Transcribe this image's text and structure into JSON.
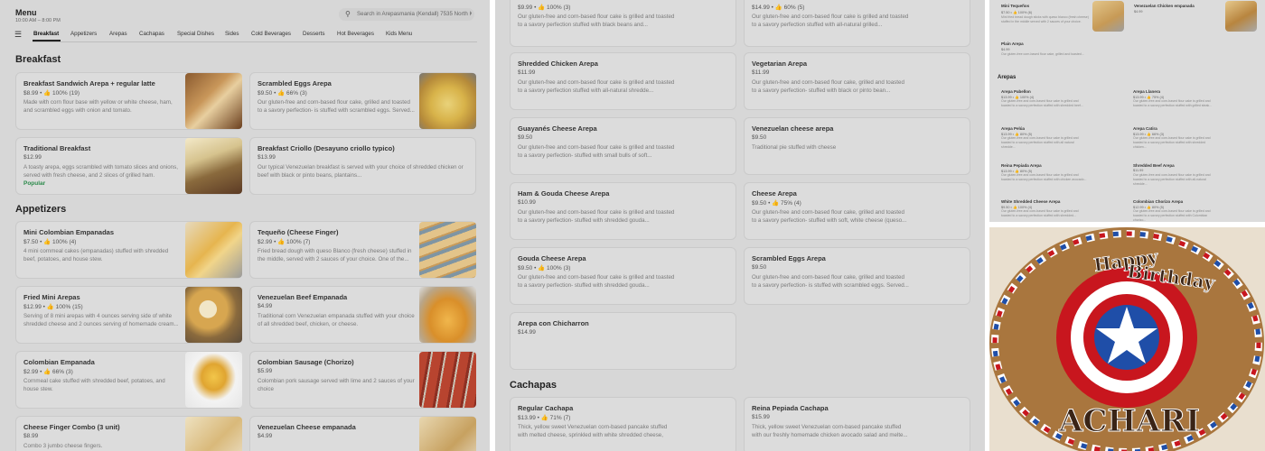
{
  "menu": {
    "title": "Menu",
    "hours": "10:00 AM – 8:00 PM",
    "search_placeholder": "Search in Arepasmania (Kendall) 7535 North K...",
    "tabs": [
      "Breakfast",
      "Appetizers",
      "Arepas",
      "Cachapas",
      "Special Dishes",
      "Sides",
      "Cold Beverages",
      "Desserts",
      "Hot Beverages",
      "Kids Menu"
    ],
    "active_tab": "Breakfast"
  },
  "breakfast": {
    "title": "Breakfast",
    "items": [
      {
        "name": "Breakfast Sandwich Arepa + regular latte",
        "price": "$8.99 • 👍 100% (19)",
        "desc": "Made with corn flour base with yellow or white cheese, ham, and scrambled eggs with onion and tomato."
      },
      {
        "name": "Scrambled Eggs Arepa",
        "price": "$9.50 • 👍 66% (3)",
        "desc": "Our gluten-free and corn-based flour cake, grilled and toasted to a savory perfection- is stuffed with scrambled eggs. Served..."
      },
      {
        "name": "Traditional Breakfast",
        "price": "$12.99",
        "desc": "A toasty arepa, eggs scrambled with tomato slices and onions, served with fresh cheese, and 2 slices of grilled ham.",
        "badge": "Popular"
      },
      {
        "name": "Breakfast Criollo (Desayuno criollo typico)",
        "price": "$13.99",
        "desc": "Our typical Venezuelan breakfast is served with your choice of shredded chicken or beef with black or pinto beans, plantains..."
      }
    ]
  },
  "appetizers": {
    "title": "Appetizers",
    "items": [
      {
        "name": "Mini Colombian Empanadas",
        "price": "$7.50 • 👍 100% (4)",
        "desc": "4 mini cornmeal cakes (empanadas) stuffed with shredded beef, potatoes, and house stew."
      },
      {
        "name": "Tequeño (Cheese Finger)",
        "price": "$2.99 • 👍 100% (7)",
        "desc": "Fried bread dough with queso Blanco (fresh cheese) stuffed in the middle, served with 2 sauces of your choice. One of the..."
      },
      {
        "name": "Fried Mini Arepas",
        "price": "$12.99 • 👍 100% (15)",
        "desc": "Serving of 8 mini arepas with 4 ounces serving side of white shredded cheese and 2 ounces serving of homemade cream..."
      },
      {
        "name": "Venezuelan Beef Empanada",
        "price": "$4.99",
        "desc": "Traditional corn Venezuelan empanada stuffed with your choice of all shredded beef, chicken, or cheese."
      },
      {
        "name": "Colombian Empanada",
        "price": "$2.99 • 👍 66% (3)",
        "desc": "Cornmeal cake stuffed with shredded beef, potatoes, and house stew."
      },
      {
        "name": "Colombian Sausage (Chorizo)",
        "price": "$5.99",
        "desc": "Colombian pork sausage served with lime and 2 sauces of your choice"
      },
      {
        "name": "Cheese Finger Combo (3 unit)",
        "price": "$8.99",
        "desc": "Combo 3 jumbo cheese fingers."
      },
      {
        "name": "Venezuelan Cheese empanada",
        "price": "$4.99",
        "desc": ""
      }
    ]
  },
  "arepas_list": {
    "top_left": {
      "price": "$9.99 • 👍 100% (3)",
      "desc": "Our gluten-free and corn-based flour cake is grilled and toasted to a savory perfection stuffed with black beans and..."
    },
    "top_right": {
      "price": "$14.99 • 👍 60% (5)",
      "desc": "Our gluten-free and corn-based flour cake is grilled and toasted to a savory perfection stuffed with all-natural grilled..."
    },
    "items": [
      {
        "name": "Shredded Chicken Arepa",
        "price": "$11.99",
        "desc": "Our gluten-free and corn-based flour cake is grilled and toasted to a savory perfection stuffed with all-natural shredde..."
      },
      {
        "name": "Vegetarian Arepa",
        "price": "$11.99",
        "desc": "Our gluten-free and corn-based flour cake, grilled and toasted to a savory perfection- stuffed with black or pinto bean..."
      },
      {
        "name": "Guayanés Cheese Arepa",
        "price": "$9.50",
        "desc": "Our gluten-free and corn-based flour cake is grilled and toasted to a savory perfection- stuffed with small bulls of soft..."
      },
      {
        "name": "Venezuelan cheese arepa",
        "price": "$9.50",
        "desc": "Traditional pie stuffed with cheese"
      },
      {
        "name": "Ham & Gouda Cheese Arepa",
        "price": "$10.99",
        "desc": "Our gluten-free and corn-based flour cake is grilled and toasted to a savory perfection- stuffed with shredded gouda..."
      },
      {
        "name": "Cheese Arepa",
        "price": "$9.50 • 👍 75% (4)",
        "desc": "Our gluten-free and corn-based flour cake, grilled and toasted to a savory perfection- stuffed with soft, white cheese (queso..."
      },
      {
        "name": "Gouda Cheese Arepa",
        "price": "$9.50 • 👍 100% (3)",
        "desc": "Our gluten-free and corn-based flour cake is grilled and toasted to a savory perfection- stuffed with shredded gouda..."
      },
      {
        "name": "Scrambled Eggs Arepa",
        "price": "$9.50",
        "desc": "Our gluten-free and corn-based flour cake, grilled and toasted to a savory perfection- is stuffed with scrambled eggs. Served..."
      },
      {
        "name": "Arepa con Chicharron",
        "price": "$14.99",
        "desc": ""
      }
    ]
  },
  "cachapas": {
    "title": "Cachapas",
    "items": [
      {
        "name": "Regular Cachapa",
        "price": "$13.99 • 👍 71% (7)",
        "desc": "Thick, yellow sweet Venezuelan corn-based pancake stuffed with melted cheese, sprinkled with white shredded cheese, and..."
      },
      {
        "name": "Reina Pepiada Cachapa",
        "price": "$15.99",
        "desc": "Thick, yellow sweet Venezuelan corn-based pancake stuffed with our freshly homemade chicken avocado salad and melte..."
      }
    ]
  },
  "mini_menu": {
    "top": [
      {
        "name": "Mini Tequeños",
        "price": "$7.50 • 👍 100% (6)",
        "desc": "Mini fried bread dough sticks with queso blanco (fresh cheese) stuffed in the middle served with 2 sauces of your choice."
      },
      {
        "name": "Venezuelan Chicken empanada",
        "price": "$4.99",
        "desc": ""
      },
      {
        "name": "Plain Arepa",
        "price": "$4.99",
        "desc": "Our gluten-free corn-based flour cake, grilled and toasted..."
      }
    ],
    "section": "Arepas",
    "items": [
      {
        "name": "Arepa Pabellon",
        "price": "$13.99 • 👍 100% (4)",
        "desc": "Our gluten-free and corn-based flour cake is grilled and toasted to a savory perfection stuffed with shredded beef..."
      },
      {
        "name": "Arepa Llanera",
        "price": "$13.99 • 👍 75% (4)",
        "desc": "Our gluten-free and corn-based flour cake is grilled and toasted to a savory perfection stuffed with grilled steak..."
      },
      {
        "name": "Arepa Pelúa",
        "price": "$13.99 • 👍 80% (5)",
        "desc": "Our gluten-free and corn-based flour cake is grilled and toasted to a savory perfection stuffed with all natural shredde..."
      },
      {
        "name": "Arepa Catira",
        "price": "$13.99 • 👍 66% (3)",
        "desc": "Our gluten-free and corn-based flour cake is grilled and toasted to a savory perfection stuffed with shredded chicken..."
      },
      {
        "name": "Reina Pepiada Arepa",
        "price": "$13.99 • 👍 80% (5)",
        "desc": "Our gluten-free and corn-based flour cake is grilled and toasted to a savory perfection stuffed with chicken avocado..."
      },
      {
        "name": "Shredded Beef Arepa",
        "price": "$11.99",
        "desc": "Our gluten-free and corn-based flour cake is grilled and toasted to a savory perfection stuffed with all-natural shredde..."
      },
      {
        "name": "White Shredded Cheese Arepa",
        "price": "$9.50 • 👍 100% (4)",
        "desc": "Our gluten-free and corn-based flour cake is grilled and toasted to a savory perfection stuffed with shredded..."
      },
      {
        "name": "Colombian Chorizo Arepa",
        "price": "$12.99 • 👍 80% (5)",
        "desc": "Our gluten-free and corn-based flour cake is grilled and toasted to a savory perfection stuffed with Colombian chorizo..."
      }
    ]
  },
  "cookie": {
    "line1": "Happy",
    "line2": "Birthday",
    "name": "ACHARI",
    "colors": {
      "red": "#c8161e",
      "blue": "#1f4ea8",
      "white": "#ffffff",
      "cookie": "#a9763e",
      "background": "#e9dfcf"
    }
  },
  "icons": {
    "search": "search-icon",
    "list": "list-icon",
    "thumbs_up": "thumbs-up-icon"
  }
}
